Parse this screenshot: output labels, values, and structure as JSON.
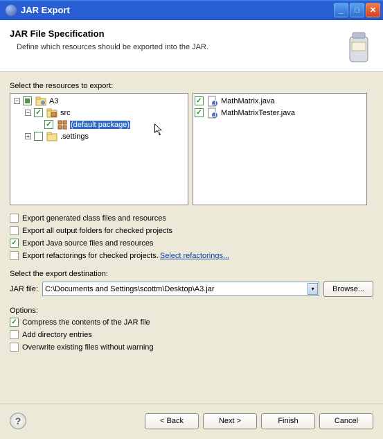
{
  "window": {
    "title": "JAR Export"
  },
  "header": {
    "title": "JAR File Specification",
    "desc": "Define which resources should be exported into the JAR."
  },
  "labels": {
    "selectResources": "Select the resources to export:",
    "exportDest": "Select the export destination:",
    "jarFile": "JAR file:",
    "browse": "Browse...",
    "options": "Options:",
    "selectRefactorings": "Select refactorings...",
    "back": "< Back",
    "next": "Next >",
    "finish": "Finish",
    "cancel": "Cancel"
  },
  "leftTree": {
    "project": "A3",
    "src": "src",
    "defaultPackage": "(default package)",
    "settings": ".settings"
  },
  "rightTree": {
    "f1": "MathMatrix.java",
    "f2": "MathMatrixTester.java"
  },
  "exportOpts": {
    "genClass": {
      "label": "Export generated class files and resources",
      "checked": false
    },
    "outputFolders": {
      "label": "Export all output folders for checked projects",
      "checked": false
    },
    "javaSource": {
      "label": "Export Java source files and resources",
      "checked": true
    },
    "refactorings": {
      "label": "Export refactorings for checked projects.",
      "checked": false
    }
  },
  "dest": {
    "value": "C:\\Documents and Settings\\scottm\\Desktop\\A3.jar"
  },
  "jarOpts": {
    "compress": {
      "label": "Compress the contents of the JAR file",
      "checked": true
    },
    "addDir": {
      "label": "Add directory entries",
      "checked": false
    },
    "overwrite": {
      "label": "Overwrite existing files without warning",
      "checked": false
    }
  }
}
